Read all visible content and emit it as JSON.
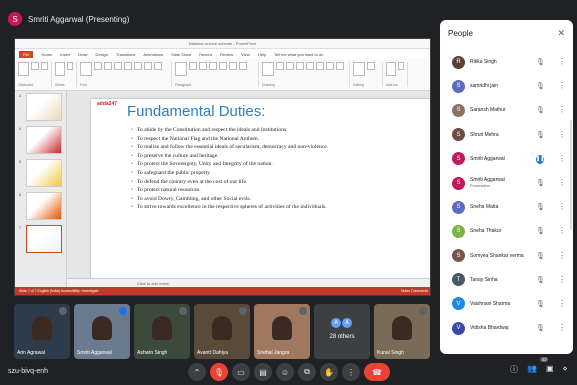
{
  "presenter": {
    "initial": "S",
    "label": "Smriti Aggarwal (Presenting)"
  },
  "ppt": {
    "window_title": "National service scheme - PowerPoint",
    "tabs": [
      "File",
      "Home",
      "Insert",
      "Draw",
      "Design",
      "Transitions",
      "Animations",
      "Slide Show",
      "Record",
      "Review",
      "View",
      "Help",
      "Tell me what you want to do"
    ],
    "ribbon_groups": [
      "Clipboard",
      "Slides",
      "Font",
      "Paragraph",
      "Drawing",
      "Editing",
      "Add-ins"
    ],
    "slide_numbers": [
      "3",
      "4",
      "5",
      "6",
      "7"
    ],
    "slide_logo": "adda247",
    "slide_title": "Fundamental Duties:",
    "duties": [
      "To abide by the Constitution and respect the ideals and Institutions.",
      "To respect the National Flag and the National Anthem.",
      "To realize and follow the essential ideals of secularism, democracy and non-violence.",
      "To preserve the culture and heritage.",
      "To protect the Sovereignty, Unity and Integrity of the nation.",
      "To safeguard the public property.",
      "To defend the country even at the cost of our life.",
      "To protect natural resources.",
      "To avoid Dowry, Gambling, and other Social evils.",
      "To strive towards excellence in the respective spheres of activities of the individuals."
    ],
    "notes": "Click to add notes",
    "status_left": "Slide 7 of 7   English (India)   Accessibility: Investigate",
    "status_right": "Notes   Comments"
  },
  "tiles": [
    {
      "name": "Arin Agrawal",
      "mic_color": "#5f6368",
      "bg": "#2d3b4a"
    },
    {
      "name": "Smriti Aggarwal",
      "mic_color": "#1a73e8",
      "bg": "#6b7b8f"
    },
    {
      "name": "Ashwin Singh",
      "mic_color": "#5f6368",
      "bg": "#3c4a3c"
    },
    {
      "name": "Avantt Dahiya",
      "mic_color": "#5f6368",
      "bg": "#5a4a3a"
    },
    {
      "name": "Snehal Jangra",
      "mic_color": "#5f6368",
      "bg": "#a07860"
    },
    {
      "name": "Kunal Singh",
      "mic_color": "#5f6368",
      "bg": "#7a6a58"
    }
  ],
  "others": {
    "count_label": "28 others",
    "initials": [
      "A",
      "A"
    ]
  },
  "bottom": {
    "meeting_code": "szu-bivq-enh",
    "participant_badge": "32"
  },
  "people_panel": {
    "title": "People",
    "people": [
      {
        "name": "Ritika Singh",
        "sub": "",
        "initial": "R",
        "color": "#5d4037",
        "mic": "off"
      },
      {
        "name": "samridhi jain",
        "sub": "",
        "initial": "S",
        "color": "#5c6bc0",
        "mic": "off"
      },
      {
        "name": "Saransh Mathur",
        "sub": "",
        "initial": "S",
        "color": "#8d6e63",
        "mic": "off"
      },
      {
        "name": "Shruti Mehra",
        "sub": "",
        "initial": "S",
        "color": "#6d4c41",
        "mic": "off"
      },
      {
        "name": "Smriti Aggarwal",
        "sub": "",
        "initial": "S",
        "color": "#c2185b",
        "mic": "on"
      },
      {
        "name": "Smriti Aggarwal",
        "sub": "Presentation",
        "initial": "S",
        "color": "#c2185b",
        "mic": "off"
      },
      {
        "name": "Sneha Matta",
        "sub": "",
        "initial": "S",
        "color": "#5c6bc0",
        "mic": "off"
      },
      {
        "name": "Sneha Thakur",
        "sub": "",
        "initial": "S",
        "color": "#7cb342",
        "mic": "off"
      },
      {
        "name": "Somyea Shankar verma",
        "sub": "",
        "initial": "S",
        "color": "#795548",
        "mic": "off"
      },
      {
        "name": "Tanay Sinha",
        "sub": "",
        "initial": "T",
        "color": "#455a64",
        "mic": "off"
      },
      {
        "name": "Vaishnavi Sharma",
        "sub": "",
        "initial": "V",
        "color": "#1e88e5",
        "mic": "off"
      },
      {
        "name": "Vidisha Bhardwaj",
        "sub": "",
        "initial": "V",
        "color": "#3949ab",
        "mic": "off"
      }
    ]
  }
}
